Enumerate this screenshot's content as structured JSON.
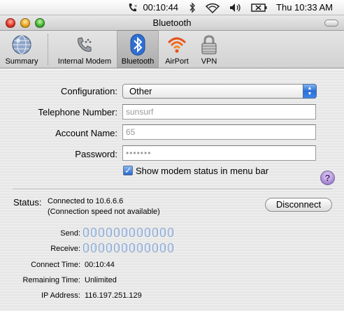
{
  "menubar": {
    "time_elapsed": "00:10:44",
    "clock": "Thu 10:33 AM",
    "icons": [
      "phone-icon",
      "bluetooth-icon",
      "wifi-icon",
      "volume-icon",
      "battery-icon"
    ]
  },
  "window": {
    "title": "Bluetooth"
  },
  "toolbar": {
    "items": [
      {
        "label": "Summary",
        "icon": "globe-icon"
      },
      {
        "label": "Internal Modem",
        "icon": "phone-icon"
      },
      {
        "label": "Bluetooth",
        "icon": "bluetooth-icon"
      },
      {
        "label": "AirPort",
        "icon": "airport-icon"
      },
      {
        "label": "VPN",
        "icon": "lock-icon"
      }
    ],
    "selected": "Bluetooth"
  },
  "form": {
    "configuration_label": "Configuration:",
    "configuration_value": "Other",
    "telephone_label": "Telephone Number:",
    "telephone_value": "sunsurf",
    "account_label": "Account Name:",
    "account_value": "65",
    "password_label": "Password:",
    "password_value": "•••••••",
    "show_status_label": "Show modem status in menu bar",
    "show_status_checked": true
  },
  "status": {
    "label": "Status:",
    "line1": "Connected to 10.6.6.6",
    "line2": "(Connection speed not available)",
    "disconnect_label": "Disconnect",
    "send_label": "Send:",
    "receive_label": "Receive:",
    "connect_time_label": "Connect Time:",
    "connect_time_value": "00:10:44",
    "remaining_time_label": "Remaining Time:",
    "remaining_time_value": "Unlimited",
    "ip_label": "IP Address:",
    "ip_value": "116.197.251.129"
  },
  "colors": {
    "accent": "#2a6fd6",
    "help": "#a482d2"
  }
}
